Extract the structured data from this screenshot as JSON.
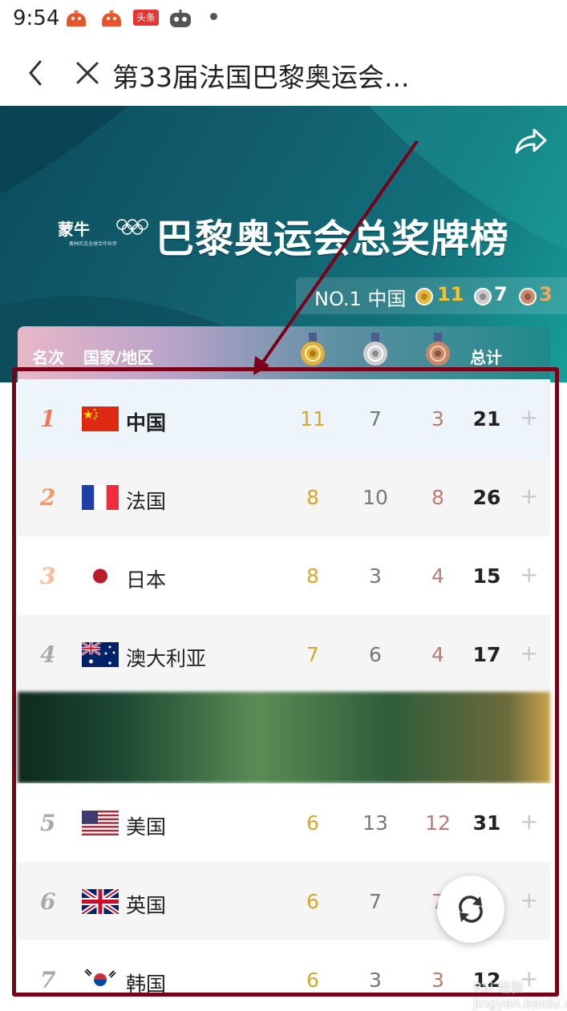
{
  "status_bar": {
    "time": "9:54",
    "badge": "头条"
  },
  "nav": {
    "title": "第33届法国巴黎奥运会..."
  },
  "banner": {
    "brand": "蒙牛",
    "brand_tagline": "奥林匹克全球合作伙伴",
    "title": "巴黎奥运会总奖牌榜",
    "leader": {
      "label": "NO.1 中国",
      "gold": "11",
      "silver": "7",
      "bronze": "3"
    }
  },
  "table": {
    "headers": {
      "rank": "名次",
      "country": "国家/地区",
      "total": "总计"
    },
    "rows": [
      {
        "rank": "1",
        "country": "中国",
        "gold": "11",
        "silver": "7",
        "bronze": "3",
        "total": "21"
      },
      {
        "rank": "2",
        "country": "法国",
        "gold": "8",
        "silver": "10",
        "bronze": "8",
        "total": "26"
      },
      {
        "rank": "3",
        "country": "日本",
        "gold": "8",
        "silver": "3",
        "bronze": "4",
        "total": "15"
      },
      {
        "rank": "4",
        "country": "澳大利亚",
        "gold": "7",
        "silver": "6",
        "bronze": "4",
        "total": "17"
      },
      {
        "rank": "5",
        "country": "美国",
        "gold": "6",
        "silver": "13",
        "bronze": "12",
        "total": "31"
      },
      {
        "rank": "6",
        "country": "英国",
        "gold": "6",
        "silver": "7",
        "bronze": "7",
        "total": ""
      },
      {
        "rank": "7",
        "country": "韩国",
        "gold": "6",
        "silver": "3",
        "bronze": "3",
        "total": "12"
      }
    ],
    "expand_symbol": "+"
  },
  "watermark": "Bai 经验 jingyan.baidu.com",
  "colors": {
    "gold": "#d6a829",
    "silver": "#777777",
    "bronze": "#b97c73",
    "frame": "#7a0018",
    "rank1": "#f07a5a"
  }
}
